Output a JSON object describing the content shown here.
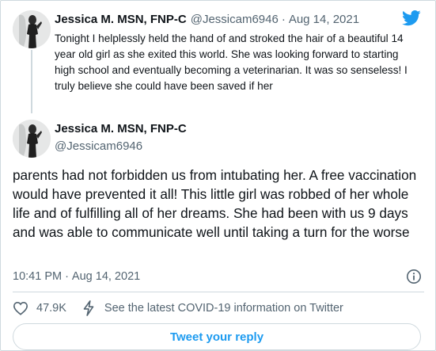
{
  "parent_tweet": {
    "display_name": "Jessica M. MSN, FNP-C",
    "handle": "@Jessicam6946",
    "separator": "·",
    "date": "Aug 14, 2021",
    "text": "Tonight I helplessly held the hand of and stroked the hair of a beautiful 14 year old girl as she exited this world. She was looking forward to starting high school and eventually becoming a veterinarian. It was so senseless! I truly believe she could have been saved if her"
  },
  "main_tweet": {
    "display_name": "Jessica M. MSN, FNP-C",
    "handle": "@Jessicam6946",
    "text": "parents had not forbidden us from intubating her. A free vaccination would have prevented it all! This little girl was robbed of her whole life and of fulfilling all of her dreams. She had been with us 9 days and was able to communicate well until taking a turn for the worse",
    "time": "10:41 PM",
    "separator": "·",
    "date": "Aug 14, 2021"
  },
  "actions": {
    "like_count": "47.9K",
    "covid_link": "See the latest COVID-19 information on Twitter"
  },
  "reply_button": {
    "label": "Tweet your reply"
  },
  "colors": {
    "brand_blue": "#1d9bf0",
    "text_primary": "#0f1419",
    "text_secondary": "#536471",
    "border": "#cfd9de"
  },
  "icons": {
    "logo": "twitter-bird-icon",
    "like": "heart-icon",
    "info": "info-icon",
    "covid": "lightning-icon"
  }
}
